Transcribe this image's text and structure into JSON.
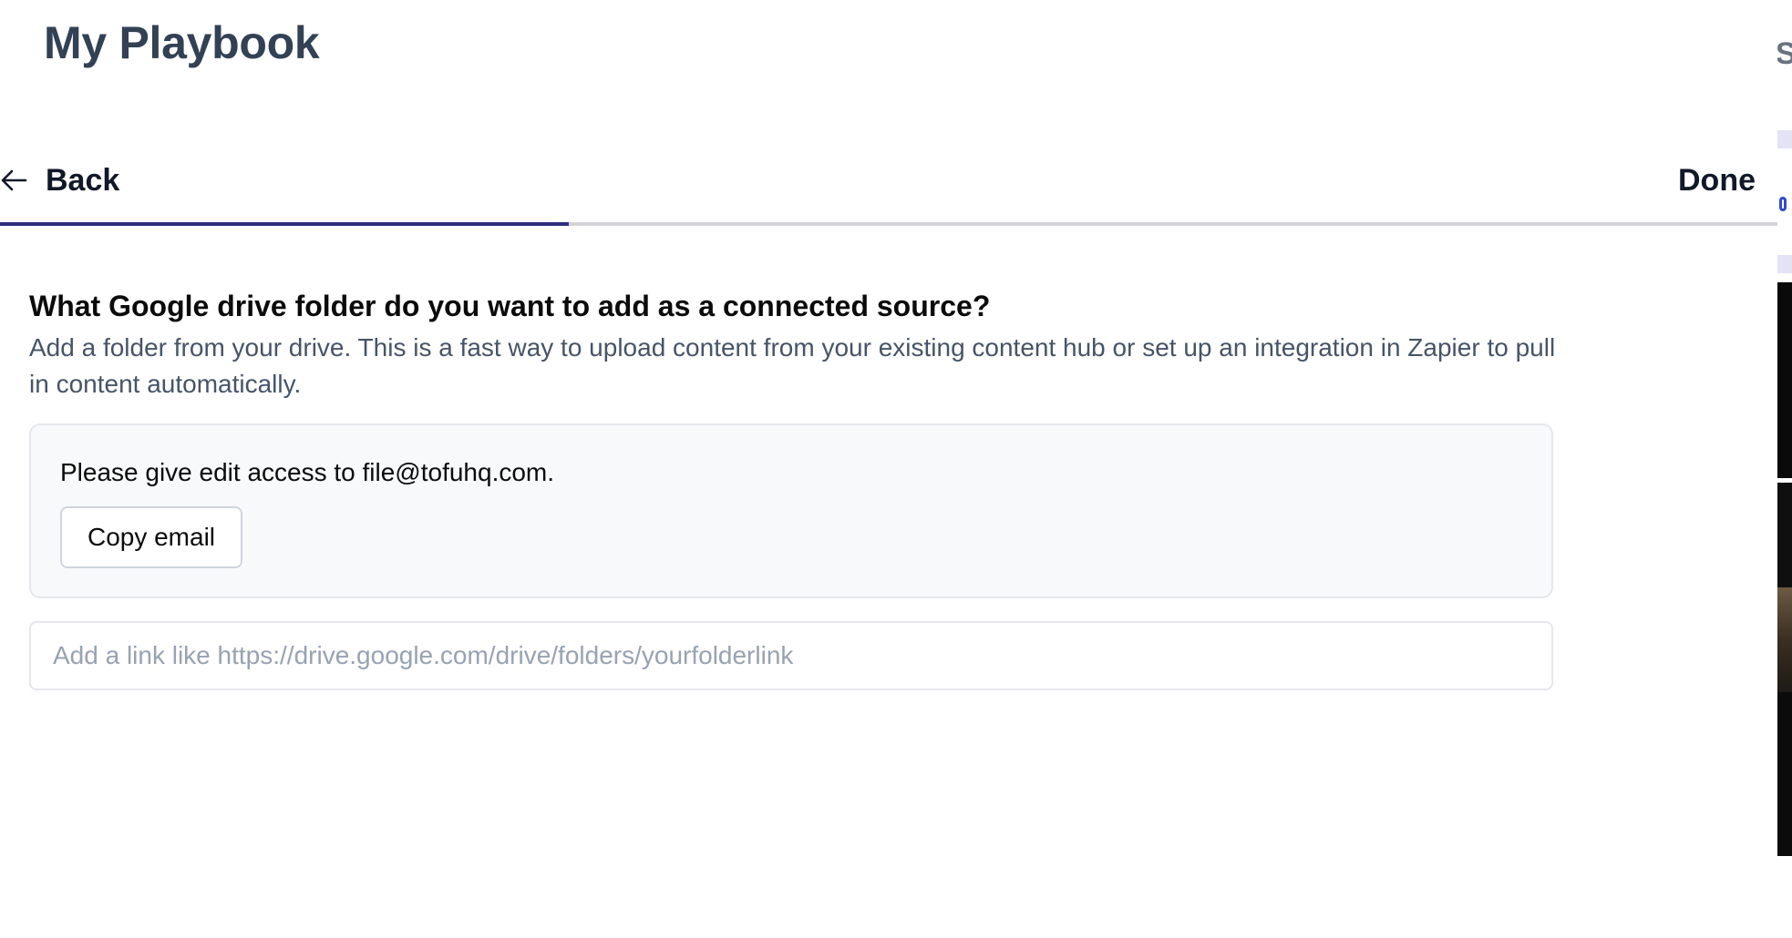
{
  "header": {
    "title": "My Playbook"
  },
  "nav": {
    "back_label": "Back",
    "done_label": "Done",
    "progress_fraction": 0.32
  },
  "question": {
    "heading": "What Google drive folder do you want to add as a connected source?",
    "description": "Add a folder from your drive. This is a fast way to upload content from your existing content hub or set up an integration in Zapier to pull in content automatically."
  },
  "access_card": {
    "message": "Please give edit access to file@tofuhq.com.",
    "copy_button_label": "Copy email"
  },
  "link_input": {
    "value": "",
    "placeholder": "Add a link like https://drive.google.com/drive/folders/yourfolderlink"
  },
  "icons": {
    "back": "arrow-left-icon"
  },
  "colors": {
    "title": "#334155",
    "progress_fill": "#312e81",
    "progress_track": "#d4d4d8"
  }
}
